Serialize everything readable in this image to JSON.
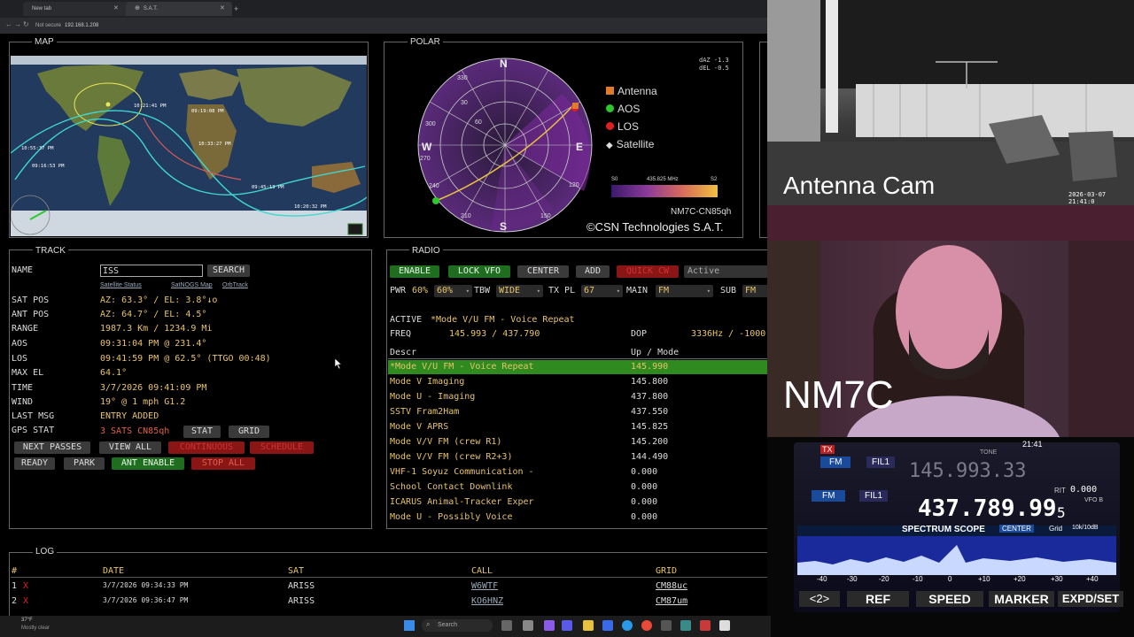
{
  "browser": {
    "tabs": [
      "New tab",
      "S.A.T."
    ],
    "security": "Not secure",
    "url": "192.168.1.208"
  },
  "map": {
    "title": "MAP",
    "labels": [
      "10:21:41 PM",
      "09:19:08 PM",
      "10:33:27 PM",
      "10:55:37 PM",
      "09:16:53 PM",
      "09:45:13 PM",
      "10:20:32 PM"
    ]
  },
  "polar": {
    "title": "POLAR",
    "daz": "dAZ -1.3",
    "del": "dEL -0.5",
    "compass": {
      "n": "N",
      "s": "S",
      "e": "E",
      "w": "W"
    },
    "ticks": [
      "330",
      "30",
      "60",
      "300",
      "270",
      "240",
      "120",
      "150",
      "210",
      "240",
      "60"
    ],
    "legend": [
      {
        "label": "Antenna",
        "color": "#e07b2a",
        "shape": "square"
      },
      {
        "label": "AOS",
        "color": "#2ec82e",
        "shape": "circle"
      },
      {
        "label": "LOS",
        "color": "#e02020",
        "shape": "circle"
      },
      {
        "label": "Satellite",
        "color": "#dddddd",
        "shape": "diamond"
      }
    ],
    "spectrum_s0": "S0",
    "spectrum_freq": "435.825 MHz",
    "spectrum_s2": "S2",
    "station": "NM7C-CN85qh",
    "copyright": "©CSN Technologies S.A.T."
  },
  "track": {
    "title": "TRACK",
    "name_label": "NAME",
    "name_value": "ISS",
    "search_btn": "SEARCH",
    "links": [
      "Satellite Status",
      "SatNOGS Map",
      "OrbTrack"
    ],
    "fields": [
      {
        "label": "SAT POS",
        "value": "AZ: 63.3° / EL: 3.8°↓o"
      },
      {
        "label": "ANT POS",
        "value": "AZ: 64.7° / EL: 4.5°"
      },
      {
        "label": "RANGE",
        "value": "1987.3 Km / 1234.9 Mi"
      },
      {
        "label": "AOS",
        "value": "09:31:04 PM @ 231.4°"
      },
      {
        "label": "LOS",
        "value": "09:41:59 PM @ 62.5° (TTGO 00:48)"
      },
      {
        "label": "MAX EL",
        "value": "64.1°"
      },
      {
        "label": "TIME",
        "value": "3/7/2026 09:41:09 PM"
      },
      {
        "label": "WIND",
        "value": "19° @ 1 mph G1.2"
      },
      {
        "label": "LAST MSG",
        "value": "ENTRY ADDED"
      },
      {
        "label": "GPS STAT",
        "value": "3 SATS CN85qh"
      }
    ],
    "stat_btn": "STAT",
    "grid_btn": "GRID",
    "buttons_row1": [
      "NEXT PASSES",
      "VIEW ALL",
      "CONTINUOUS",
      "SCHEDULE"
    ],
    "buttons_row2": [
      "READY",
      "PARK",
      "ANT ENABLE",
      "STOP ALL"
    ]
  },
  "radio": {
    "title": "RADIO",
    "buttons": [
      "ENABLE",
      "LOCK VFO",
      "CENTER",
      "ADD",
      "QUICK CW"
    ],
    "status": "Active",
    "pwr_label": "PWR",
    "pwr_value": "60%",
    "pwr_select": "60%",
    "tbw_label": "TBW",
    "tbw_select": "WIDE",
    "txpl_label": "TX PL",
    "txpl_select": "67",
    "main_label": "MAIN",
    "main_select": "FM",
    "sub_label": "SUB",
    "sub_select": "FM",
    "active_label": "ACTIVE",
    "active_value": "*Mode V/U FM - Voice Repeat",
    "freq_label": "FREQ",
    "freq_value": "145.993 / 437.790",
    "dop_label": "DOP",
    "dop_value": "3336Hz / -1000",
    "col_descr": "Descr",
    "col_updown": "Up / Mode",
    "rows": [
      {
        "descr": "*Mode V/U FM - Voice Repeat",
        "up": "145.990",
        "selected": true
      },
      {
        "descr": "Mode V Imaging",
        "up": "145.800"
      },
      {
        "descr": "Mode U - Imaging",
        "up": "437.800"
      },
      {
        "descr": "SSTV Fram2Ham",
        "up": "437.550"
      },
      {
        "descr": "Mode V APRS",
        "up": "145.825"
      },
      {
        "descr": "Mode V/V FM (crew R1)",
        "up": "145.200"
      },
      {
        "descr": "Mode V/V FM (crew R2+3)",
        "up": "144.490"
      },
      {
        "descr": "VHF-1 Soyuz Communication -",
        "up": "0.000"
      },
      {
        "descr": "School Contact Downlink",
        "up": "0.000"
      },
      {
        "descr": "ICARUS Animal-Tracker Exper",
        "up": "0.000"
      },
      {
        "descr": "Mode U - Possibly Voice",
        "up": "0.000"
      }
    ]
  },
  "log": {
    "title": "LOG",
    "headers": [
      "#",
      "DATE",
      "SAT",
      "CALL",
      "GRID"
    ],
    "rows": [
      {
        "n": "1",
        "x": "X",
        "date": "3/7/2026 09:34:33 PM",
        "sat": "ARISS",
        "call": "W6WTF",
        "grid": "CM88uc"
      },
      {
        "n": "2",
        "x": "X",
        "date": "3/7/2026 09:36:47 PM",
        "sat": "ARISS",
        "call": "KO6HNZ",
        "grid": "CM87um"
      }
    ]
  },
  "camera": {
    "title": "Antenna Cam",
    "timestamp": "2026-03-07 21:41:0"
  },
  "webcam": {
    "callsign": "NM7C"
  },
  "rig": {
    "time": "21:41",
    "tx": "TX",
    "mode1": "FM",
    "fil1": "FIL1",
    "mode2": "FM",
    "fil2": "FIL1",
    "freq1": "145.993.33",
    "freq2_main": "437.789.99",
    "freq2_small": "5",
    "rit_label": "RIT",
    "rit_value": "0.000",
    "vfo": "VFO B",
    "tone": "TONE",
    "scope_title": "SPECTRUM SCOPE",
    "center": "CENTER",
    "grid": "Grid",
    "span": "10k/10dB",
    "scale": [
      "-40",
      "-30",
      "-20",
      "-10",
      "0",
      "+10",
      "+20",
      "+30",
      "+40"
    ],
    "softkeys": [
      "<2>",
      "REF",
      "SPEED",
      "MARKER",
      "EXPD/SET"
    ]
  },
  "taskbar": {
    "weather_temp": "37°F",
    "weather_desc": "Mostly clear",
    "search": "Search"
  }
}
